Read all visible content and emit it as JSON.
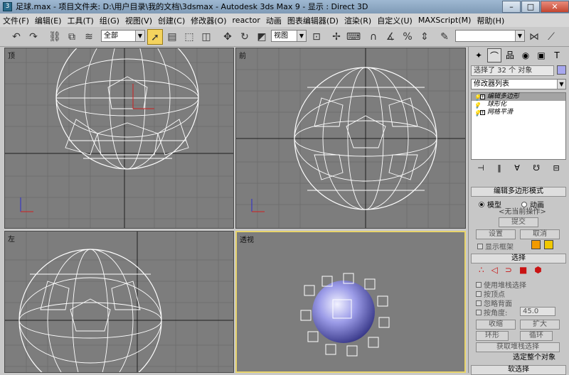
{
  "window": {
    "title": "足球.max   - 项目文件夹: D:\\用户目录\\我的文档\\3dsmax    - Autodesk 3ds Max 9    - 显示 : Direct 3D",
    "app_icon": "3ds-max-icon",
    "buttons": {
      "minimize": "–",
      "maximize": "□",
      "close": "✕"
    }
  },
  "menu": [
    "文件(F)",
    "编辑(E)",
    "工具(T)",
    "组(G)",
    "视图(V)",
    "创建(C)",
    "修改器(O)",
    "reactor",
    "动画",
    "图表编辑器(D)",
    "渲染(R)",
    "自定义(U)",
    "MAXScript(M)",
    "帮助(H)"
  ],
  "toolbar": {
    "selection_filter": "全部",
    "coord_system": "视图",
    "named_selection": ""
  },
  "viewports": {
    "top": "顶",
    "front": "前",
    "left": "左",
    "perspective": "透视"
  },
  "command_panel": {
    "object_name": "选择了 32 个 对象",
    "object_color": "#a7a7ee",
    "modifier_list": "修改器列表",
    "stack": [
      "编辑多边形",
      "球形化",
      "网格平滑"
    ],
    "edit_mode": {
      "title": "编辑多边形模式",
      "model": "模型",
      "animation": "动画",
      "no_current_op": "<无当前操作>",
      "commit": "提交",
      "settings": "设置",
      "cancel": "取消",
      "show_cage": "显示框架",
      "cage_color1": "#f29a00",
      "cage_color2": "#f0c800"
    },
    "selection": {
      "title": "选择",
      "by_vertex": "使用堆栈选择",
      "by_vertex_pt": "按顶点",
      "ignore_backface": "忽略背面",
      "by_angle": "按角度:",
      "angle_value": "45.0",
      "shrink": "收缩",
      "grow": "扩大",
      "ring": "环形",
      "loop": "循环",
      "get_stack": "获取堆栈选择",
      "status": "选定整个对象"
    },
    "soft_selection": "软选择"
  }
}
